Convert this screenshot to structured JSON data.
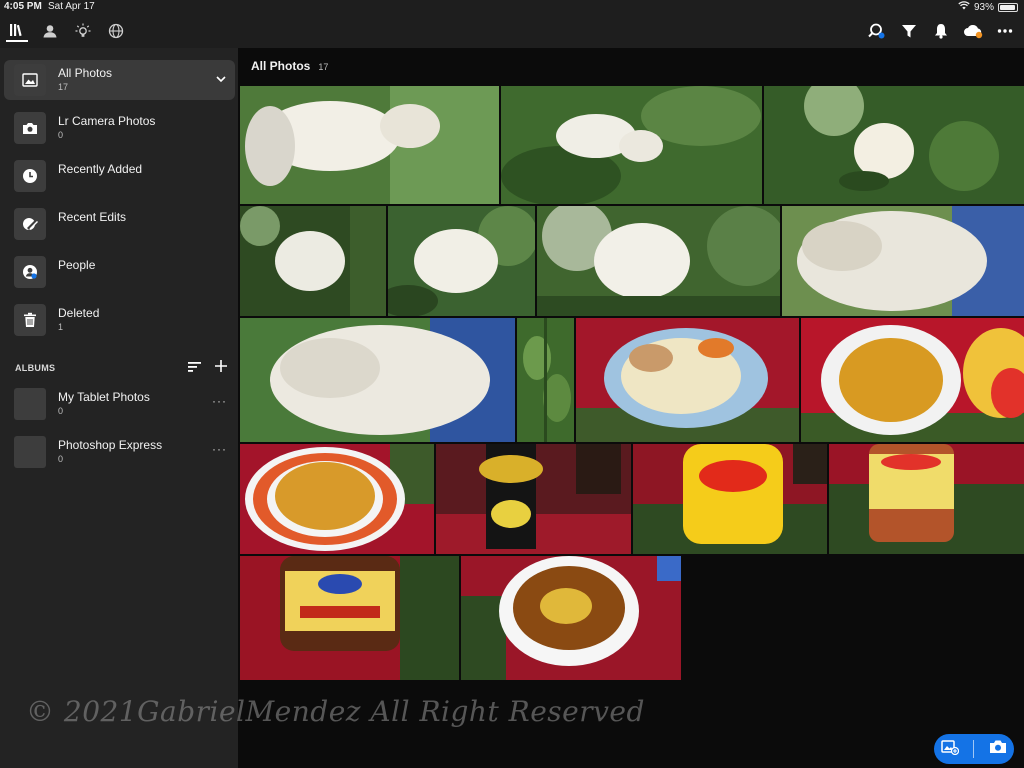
{
  "status": {
    "time": "4:05 PM",
    "date": "Sat Apr 17",
    "battery": "93%",
    "battery_level": 0.93
  },
  "toolbar": {
    "left_icons": [
      "library-icon",
      "people-icon",
      "learn-icon",
      "discover-icon"
    ],
    "right_icons": [
      "search-icon",
      "filter-icon",
      "notifications-icon",
      "cloud-sync-icon",
      "more-icon"
    ]
  },
  "sidebar": {
    "items": [
      {
        "label": "All Photos",
        "count": "17",
        "icon": "photos-icon"
      },
      {
        "label": "Lr Camera Photos",
        "count": "0",
        "icon": "camera-icon"
      },
      {
        "label": "Recently Added",
        "count": "",
        "icon": "clock-icon"
      },
      {
        "label": "Recent Edits",
        "count": "",
        "icon": "edit-icon"
      },
      {
        "label": "People",
        "count": "",
        "icon": "person-icon"
      },
      {
        "label": "Deleted",
        "count": "1",
        "icon": "trash-icon"
      }
    ],
    "albums_title": "ALBUMS",
    "albums": [
      {
        "label": "My Tablet Photos",
        "count": "0"
      },
      {
        "label": "Photoshop Express",
        "count": "0"
      }
    ]
  },
  "main": {
    "title": "All Photos",
    "count": "17"
  },
  "watermark": "© 2021GabrielMendez All Right Reserved",
  "colors": {
    "accent": "#1473e6",
    "sidebar_bg": "#232323",
    "toolbar_bg": "#1e1e1e"
  }
}
